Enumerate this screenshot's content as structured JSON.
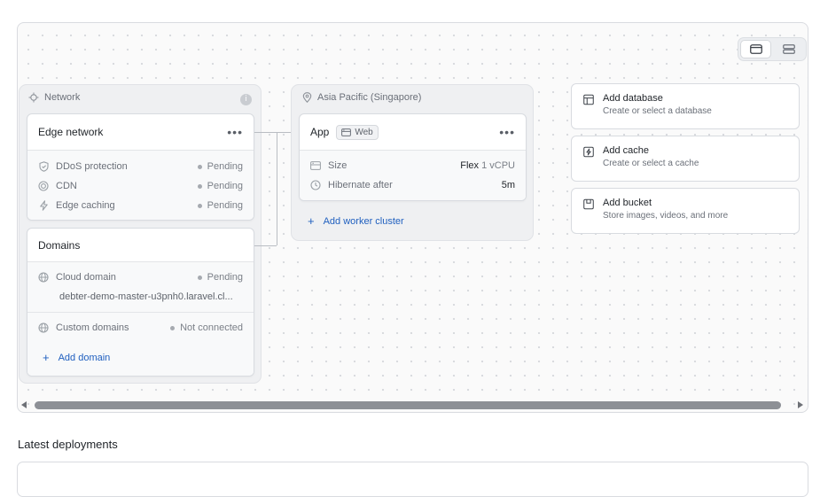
{
  "network": {
    "label": "Network",
    "edge": {
      "title": "Edge network",
      "rows": [
        {
          "icon": "shield-icon",
          "label": "DDoS protection",
          "status": "Pending"
        },
        {
          "icon": "cdn-icon",
          "label": "CDN",
          "status": "Pending"
        },
        {
          "icon": "bolt-icon",
          "label": "Edge caching",
          "status": "Pending"
        }
      ]
    },
    "domains": {
      "title": "Domains",
      "cloud_label": "Cloud domain",
      "cloud_status": "Pending",
      "cloud_value": "debter-demo-master-u3pnh0.laravel.cl...",
      "custom_label": "Custom domains",
      "custom_status": "Not connected",
      "add_label": "Add domain"
    }
  },
  "region": {
    "label": "Asia Pacific (Singapore)",
    "app": {
      "title": "App",
      "badge": "Web",
      "size_label": "Size",
      "size_prefix": "Flex",
      "size_value": "1 vCPU",
      "hibernate_label": "Hibernate after",
      "hibernate_value": "5m"
    },
    "add_worker_label": "Add worker cluster"
  },
  "resources": [
    {
      "icon": "database-icon",
      "title": "Add database",
      "subtitle": "Create or select a database"
    },
    {
      "icon": "cache-icon",
      "title": "Add cache",
      "subtitle": "Create or select a cache"
    },
    {
      "icon": "bucket-icon",
      "title": "Add bucket",
      "subtitle": "Store images, videos, and more"
    }
  ],
  "latest_deployments": "Latest deployments"
}
